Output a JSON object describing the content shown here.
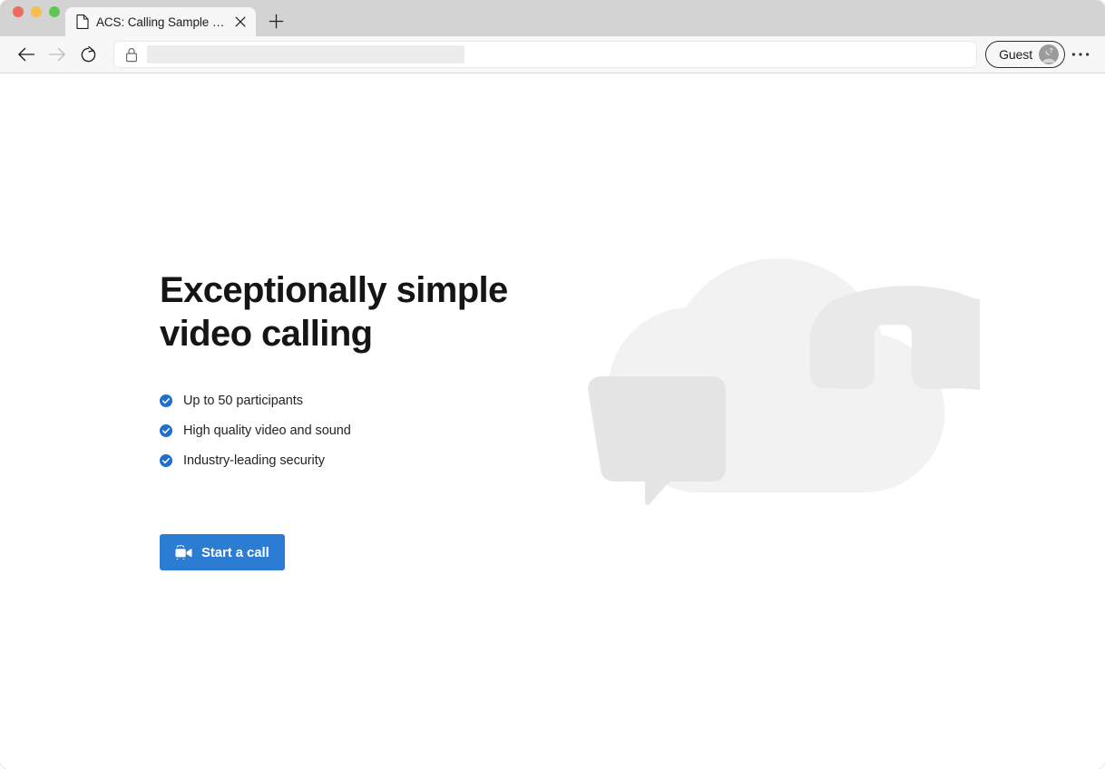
{
  "window": {
    "traffic_lights": [
      {
        "name": "close",
        "color": "#ec6a5f"
      },
      {
        "name": "minimize",
        "color": "#f4bf50"
      },
      {
        "name": "zoom",
        "color": "#61c554"
      }
    ]
  },
  "browser": {
    "tab": {
      "title": "ACS: Calling Sample app",
      "favicon": "page-icon",
      "close_icon": "close-icon"
    },
    "new_tab_icon": "plus-icon",
    "nav": {
      "back_icon": "arrow-left-icon",
      "forward_icon": "arrow-right-icon",
      "reload_icon": "reload-icon"
    },
    "address_bar": {
      "lock_icon": "lock-icon",
      "url": "",
      "placeholder": ""
    },
    "profile": {
      "label": "Guest",
      "avatar_icon": "person-question-icon"
    },
    "menu_icon": "ellipsis-icon"
  },
  "page": {
    "hero": {
      "title_line1": "Exceptionally simple",
      "title_line2": "video calling",
      "features": [
        {
          "icon": "check-circle-icon",
          "label": "Up to 50 participants"
        },
        {
          "icon": "check-circle-icon",
          "label": "High quality video and sound"
        },
        {
          "icon": "check-circle-icon",
          "label": "Industry-leading security"
        }
      ],
      "cta": {
        "label": "Start a call",
        "icon": "video-camera-icon"
      }
    },
    "illustration": {
      "name": "cloud-chat-phone-illustration",
      "shapes": [
        "cloud",
        "chat-bubble",
        "phone-handset"
      ]
    }
  },
  "colors": {
    "accent": "#2b7cd3",
    "check": "#1f6fcc",
    "illustration_light": "#f2f2f2",
    "illustration_mid": "#e8e8e8",
    "illustration_dark": "#dedede",
    "tabstrip": "#d3d3d3",
    "toolbar": "#f7f7f7",
    "page_bg": "#ffffff",
    "text": "#151515"
  }
}
